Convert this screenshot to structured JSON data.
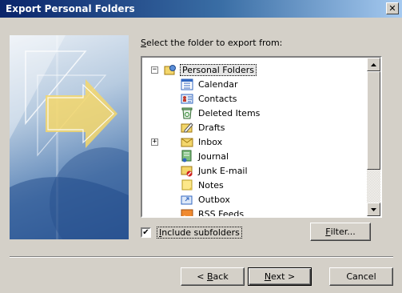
{
  "window": {
    "title": "Export Personal Folders",
    "close_glyph": "✕"
  },
  "prompt": {
    "prefix": "",
    "underlined": "S",
    "rest": "elect the folder to export from:"
  },
  "tree": {
    "root": {
      "label": "Personal Folders",
      "icon": "personal-folders-icon",
      "expander": "−"
    },
    "items": [
      {
        "label": "Calendar",
        "icon": "calendar-icon",
        "expander": ""
      },
      {
        "label": "Contacts",
        "icon": "contacts-icon",
        "expander": ""
      },
      {
        "label": "Deleted Items",
        "icon": "deleted-items-icon",
        "expander": ""
      },
      {
        "label": "Drafts",
        "icon": "drafts-icon",
        "expander": ""
      },
      {
        "label": "Inbox",
        "icon": "inbox-icon",
        "expander": "+"
      },
      {
        "label": "Journal",
        "icon": "journal-icon",
        "expander": ""
      },
      {
        "label": "Junk E-mail",
        "icon": "junk-email-icon",
        "expander": ""
      },
      {
        "label": "Notes",
        "icon": "notes-icon",
        "expander": ""
      },
      {
        "label": "Outbox",
        "icon": "outbox-icon",
        "expander": ""
      },
      {
        "label": "RSS Feeds",
        "icon": "rss-feeds-icon",
        "expander": ""
      }
    ]
  },
  "include_subfolders": {
    "checked": true,
    "mark": "✔",
    "label_underlined": "I",
    "label_rest": "nclude subfolders"
  },
  "buttons": {
    "filter": {
      "underlined": "F",
      "rest": "ilter..."
    },
    "back": {
      "prefix": "< ",
      "underlined": "B",
      "rest": "ack"
    },
    "next": {
      "underlined": "N",
      "rest": "ext >"
    },
    "cancel": {
      "label": "Cancel"
    }
  },
  "colors": {
    "titlebar_start": "#0a246a",
    "titlebar_end": "#a6caf0",
    "dialog_bg": "#d4d0c8"
  }
}
